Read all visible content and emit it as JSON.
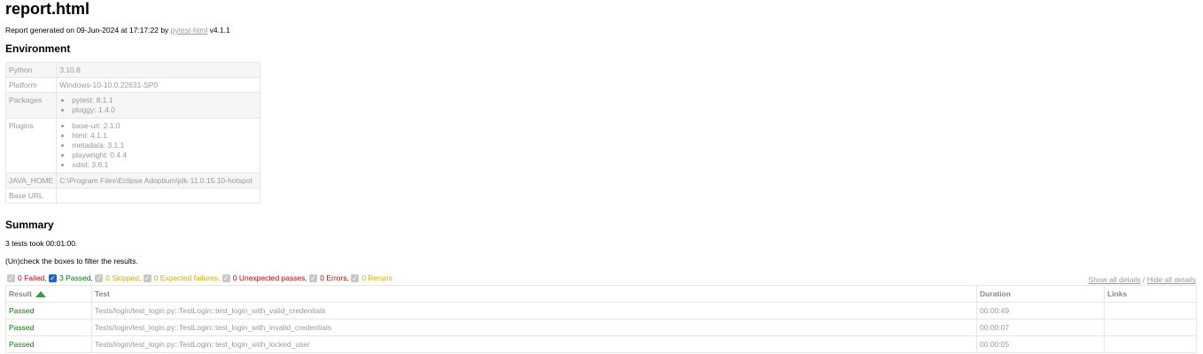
{
  "title": "report.html",
  "generated": {
    "prefix": "Report generated on 09-Jun-2024 at 17:17:22 by ",
    "link": "pytest-html",
    "suffix": " v4.1.1"
  },
  "environment": {
    "heading": "Environment",
    "rows": {
      "python": {
        "key": "Python",
        "value": "3.10.6"
      },
      "platform": {
        "key": "Platform",
        "value": "Windows-10-10.0.22631-SP0"
      },
      "packages": {
        "key": "Packages",
        "items": [
          "pytest: 8.1.1",
          "pluggy: 1.4.0"
        ]
      },
      "plugins": {
        "key": "Plugins",
        "items": [
          "base-url: 2.1.0",
          "html: 4.1.1",
          "metadata: 3.1.1",
          "playwright: 0.4.4",
          "xdist: 3.6.1"
        ]
      },
      "java_home": {
        "key": "JAVA_HOME",
        "value": "C:\\Program Files\\Eclipse Adoptium\\jdk-11.0.15.10-hotspot"
      },
      "base_url": {
        "key": "Base URL",
        "value": ""
      }
    }
  },
  "summary": {
    "heading": "Summary",
    "took": "3 tests took 00:01:00.",
    "instructions": "(Un)check the boxes to filter the results."
  },
  "filters": {
    "failed": {
      "label": "0 Failed,",
      "checked": false
    },
    "passed": {
      "label": "3 Passed,",
      "checked": true
    },
    "skipped": {
      "label": "0 Skipped,",
      "checked": false
    },
    "xfailed": {
      "label": "0 Expected failures,",
      "checked": false
    },
    "xpassed": {
      "label": "0 Unexpected passes,",
      "checked": false
    },
    "errors": {
      "label": "0 Errors,",
      "checked": false
    },
    "reruns": {
      "label": "0 Reruns",
      "checked": false
    }
  },
  "details_links": {
    "show": "Show all details",
    "separator": "/",
    "hide": "Hide all details"
  },
  "results": {
    "headers": {
      "result": "Result",
      "test": "Test",
      "duration": "Duration",
      "links": "Links"
    },
    "rows": [
      {
        "result": "Passed",
        "test": "Tests/login/test_login.py::TestLogin::test_login_with_valid_credentials",
        "duration": "00:00:49",
        "links": ""
      },
      {
        "result": "Passed",
        "test": "Tests/login/test_login.py::TestLogin::test_login_with_invalid_credentials",
        "duration": "00:00:07",
        "links": ""
      },
      {
        "result": "Passed",
        "test": "Tests/login/test_login.py::TestLogin::test_login_with_locked_user",
        "duration": "00:00:05",
        "links": ""
      }
    ]
  },
  "colors": {
    "passed": "#008000",
    "failed": "#d20000",
    "skipped": "#e6a700",
    "checkbox_checked": "#1a66d2",
    "sort_arrow": "#2ea33a"
  }
}
